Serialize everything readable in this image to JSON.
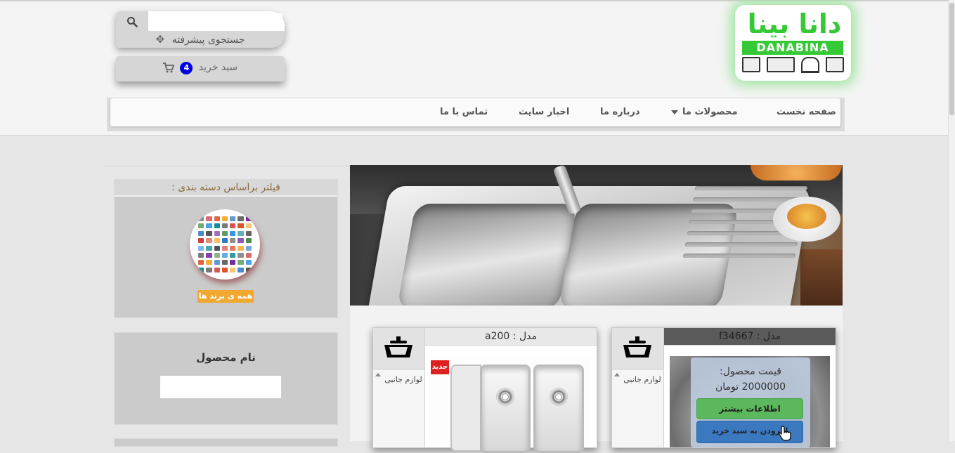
{
  "header": {
    "logo": {
      "title_fa": "دانا بینا",
      "title_latin": "DANABINA"
    },
    "search": {
      "placeholder": "",
      "advanced_label": "جستجوی پیشرفته",
      "search_icon": "search-icon",
      "advanced_icon": "move-icon"
    },
    "cart": {
      "label": "سبد خرید",
      "count": "4",
      "icon": "shopping-cart-icon",
      "badge_color": "#0000e6"
    }
  },
  "nav": {
    "items": [
      {
        "label": "صفحه نخست"
      },
      {
        "label": "محصولات ما",
        "has_dropdown": true
      },
      {
        "label": "درباره ما"
      },
      {
        "label": "اخبار سایت"
      },
      {
        "label": "تماس با ما"
      }
    ]
  },
  "sidebar": {
    "filter_title": "فیلتر براساس دسته بندی :",
    "all_brands_label": "همه ی برند ها",
    "product_name_title": "نام محصول",
    "product_name_value": ""
  },
  "products": [
    {
      "title": "مدل : a200",
      "category": "لوازم جانبی",
      "badge": "جدید",
      "icon": "sink-icon"
    },
    {
      "title": "مدل : f34667",
      "category": "لوازم جانبی",
      "icon": "sink-icon",
      "price_label": "قیمت محصول:",
      "price_value": "2000000 تومان",
      "more_label": "اطلاعات بیشتر",
      "add_to_cart_label": "افزودن به سبد خرید"
    }
  ],
  "colors": {
    "brand_green": "#36c936",
    "accent_orange": "#f0a830",
    "button_green": "#5cb85c",
    "button_blue": "#3a78c0",
    "new_badge_red": "#e02020"
  }
}
